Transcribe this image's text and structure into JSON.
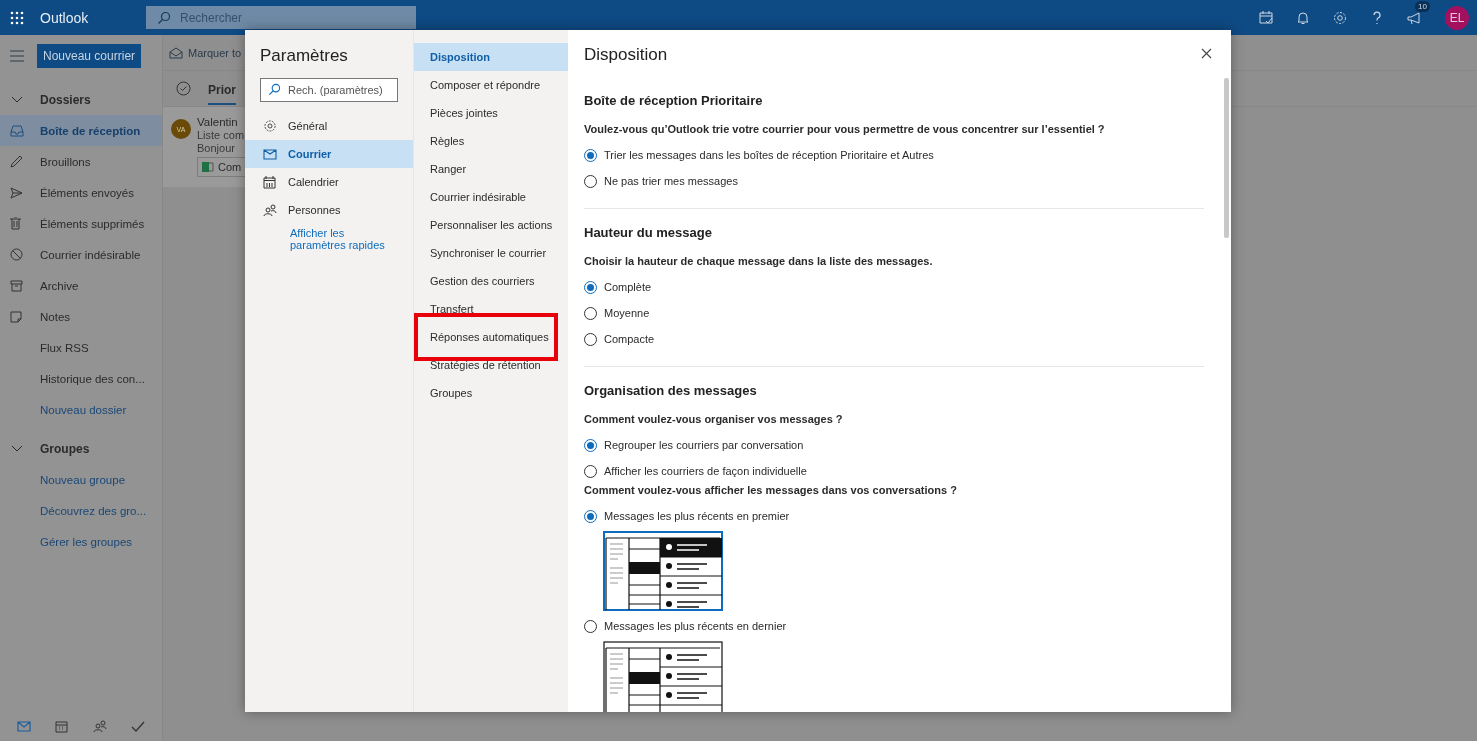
{
  "header": {
    "app_title": "Outlook",
    "search": {
      "placeholder": "Rechercher"
    },
    "badge": "10",
    "avatar": "EL"
  },
  "left_nav": {
    "new_mail": "Nouveau courrier",
    "sections": [
      {
        "heading": "Dossiers",
        "expanded": true,
        "items": [
          {
            "label": "Boîte de réception",
            "kind": "inbox",
            "selected": true
          },
          {
            "label": "Brouillons",
            "kind": "draft",
            "selected": false
          },
          {
            "label": "Éléments envoyés",
            "kind": "sent",
            "selected": false
          },
          {
            "label": "Éléments supprimés",
            "kind": "trash",
            "selected": false
          },
          {
            "label": "Courrier indésirable",
            "kind": "junk",
            "selected": false
          },
          {
            "label": "Archive",
            "kind": "archive",
            "selected": false
          },
          {
            "label": "Notes",
            "kind": "note",
            "selected": false
          },
          {
            "label": "Flux RSS",
            "kind": "plain",
            "selected": false
          },
          {
            "label": "Historique des con...",
            "kind": "plain",
            "selected": false
          },
          {
            "label": "Nouveau dossier",
            "kind": "link",
            "selected": false
          }
        ]
      },
      {
        "heading": "Groupes",
        "expanded": true,
        "items": [
          {
            "label": "Nouveau groupe",
            "kind": "link",
            "selected": false
          },
          {
            "label": "Découvrez des gro...",
            "kind": "link",
            "selected": false
          },
          {
            "label": "Gérer les groupes",
            "kind": "link",
            "selected": false
          }
        ]
      }
    ],
    "bottom": [
      {
        "kind": "mail",
        "selected": true
      },
      {
        "kind": "calendar",
        "selected": false
      },
      {
        "kind": "people",
        "selected": false
      },
      {
        "kind": "todo",
        "selected": false
      }
    ]
  },
  "mail_list": {
    "toolbar": "Marquer to",
    "tab": "Prior",
    "message": {
      "avatar": "VA",
      "sender": "Valentin",
      "subject": "Liste com",
      "preview": "Bonjour",
      "attachment": "Com"
    }
  },
  "settings": {
    "title": "Paramètres",
    "search": {
      "placeholder": "Rech. (paramètres)"
    },
    "categories": [
      {
        "label": "Général",
        "kind": "gear",
        "selected": false
      },
      {
        "label": "Courrier",
        "kind": "mail",
        "selected": true
      },
      {
        "label": "Calendrier",
        "kind": "calendar",
        "selected": false
      },
      {
        "label": "Personnes",
        "kind": "people",
        "selected": false
      }
    ],
    "quick_link": "Afficher les paramètres rapides",
    "subnav": [
      {
        "label": "Disposition",
        "selected": true,
        "highlighted": false
      },
      {
        "label": "Composer et répondre",
        "selected": false,
        "highlighted": false
      },
      {
        "label": "Pièces jointes",
        "selected": false,
        "highlighted": false
      },
      {
        "label": "Règles",
        "selected": false,
        "highlighted": false
      },
      {
        "label": "Ranger",
        "selected": false,
        "highlighted": false
      },
      {
        "label": "Courrier indésirable",
        "selected": false,
        "highlighted": false
      },
      {
        "label": "Personnaliser les actions",
        "selected": false,
        "highlighted": false
      },
      {
        "label": "Synchroniser le courrier",
        "selected": false,
        "highlighted": false
      },
      {
        "label": "Gestion des courriers",
        "selected": false,
        "highlighted": false
      },
      {
        "label": "Transfert",
        "selected": false,
        "highlighted": false
      },
      {
        "label": "Réponses automatiques",
        "selected": false,
        "highlighted": true
      },
      {
        "label": "Stratégies de rétention",
        "selected": false,
        "highlighted": false
      },
      {
        "label": "Groupes",
        "selected": false,
        "highlighted": false
      }
    ],
    "content": {
      "title": "Disposition",
      "sections": [
        {
          "heading": "Boîte de réception Prioritaire",
          "groups": [
            {
              "question": "Voulez-vous qu’Outlook trie votre courrier pour vous permettre de vous concentrer sur l’essentiel ?",
              "options": [
                {
                  "label": "Trier les messages dans les boîtes de réception Prioritaire et Autres",
                  "selected": true
                },
                {
                  "label": "Ne pas trier mes messages",
                  "selected": false
                }
              ]
            }
          ]
        },
        {
          "heading": "Hauteur du message",
          "groups": [
            {
              "question": "Choisir la hauteur de chaque message dans la liste des messages.",
              "options": [
                {
                  "label": "Complète",
                  "selected": true
                },
                {
                  "label": "Moyenne",
                  "selected": false
                },
                {
                  "label": "Compacte",
                  "selected": false
                }
              ]
            }
          ]
        },
        {
          "heading": "Organisation des messages",
          "groups": [
            {
              "question": "Comment voulez-vous organiser vos messages ?",
              "options": [
                {
                  "label": "Regrouper les courriers par conversation",
                  "selected": true
                },
                {
                  "label": "Afficher les courriers de façon individuelle",
                  "selected": false
                }
              ]
            },
            {
              "question": "Comment voulez-vous afficher les messages dans vos conversations ?",
              "options": [
                {
                  "label": "Messages les plus récents en premier",
                  "selected": true,
                  "kind": "newest-first"
                },
                {
                  "label": "Messages les plus récents en dernier",
                  "selected": false,
                  "kind": "newest-last"
                }
              ]
            }
          ]
        }
      ]
    }
  }
}
